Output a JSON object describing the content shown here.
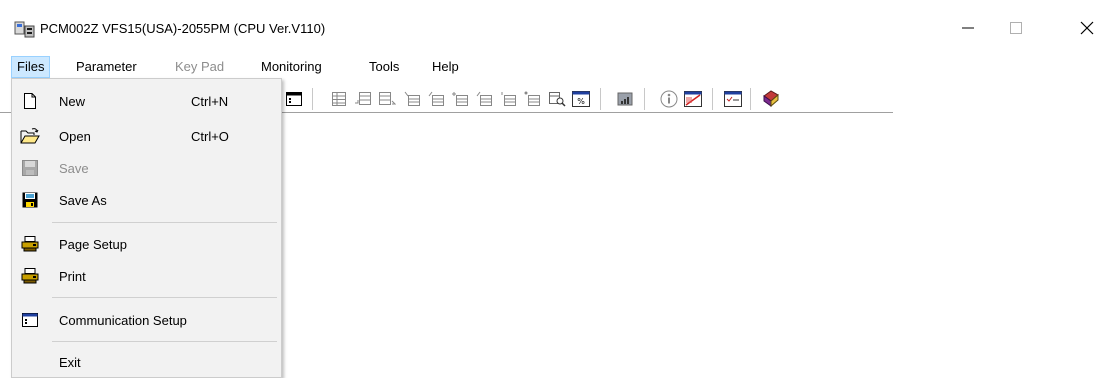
{
  "window": {
    "title": "PCM002Z VFS15(USA)-2055PM (CPU Ver.V110)",
    "icon": "app-icon"
  },
  "menubar": {
    "items": [
      {
        "label": "Files",
        "state": "active"
      },
      {
        "label": "Parameter",
        "state": "enabled"
      },
      {
        "label": "Key Pad",
        "state": "disabled"
      },
      {
        "label": "Monitoring",
        "state": "enabled"
      },
      {
        "label": "Tools",
        "state": "enabled"
      },
      {
        "label": "Help",
        "state": "enabled"
      }
    ]
  },
  "files_menu": {
    "items": [
      {
        "label": "New",
        "shortcut": "Ctrl+N",
        "icon": "new-document-icon",
        "enabled": true
      },
      {
        "label": "Open",
        "shortcut": "Ctrl+O",
        "icon": "open-folder-icon",
        "enabled": true
      },
      {
        "label": "Save",
        "shortcut": "",
        "icon": "save-icon",
        "enabled": false
      },
      {
        "label": "Save As",
        "shortcut": "",
        "icon": "save-as-icon",
        "enabled": true
      },
      {
        "label": "Page Setup",
        "shortcut": "",
        "icon": "page-setup-icon",
        "enabled": true
      },
      {
        "label": "Print",
        "shortcut": "",
        "icon": "printer-icon",
        "enabled": true
      },
      {
        "label": "Communication Setup",
        "shortcut": "",
        "icon": "communication-setup-icon",
        "enabled": true
      },
      {
        "label": "Exit",
        "shortcut": "",
        "icon": "",
        "enabled": true
      }
    ]
  },
  "colors": {
    "menu_active_bg": "#cce8ff",
    "menu_bg": "#f2f2f2",
    "disabled_text": "#8d8d8d"
  }
}
